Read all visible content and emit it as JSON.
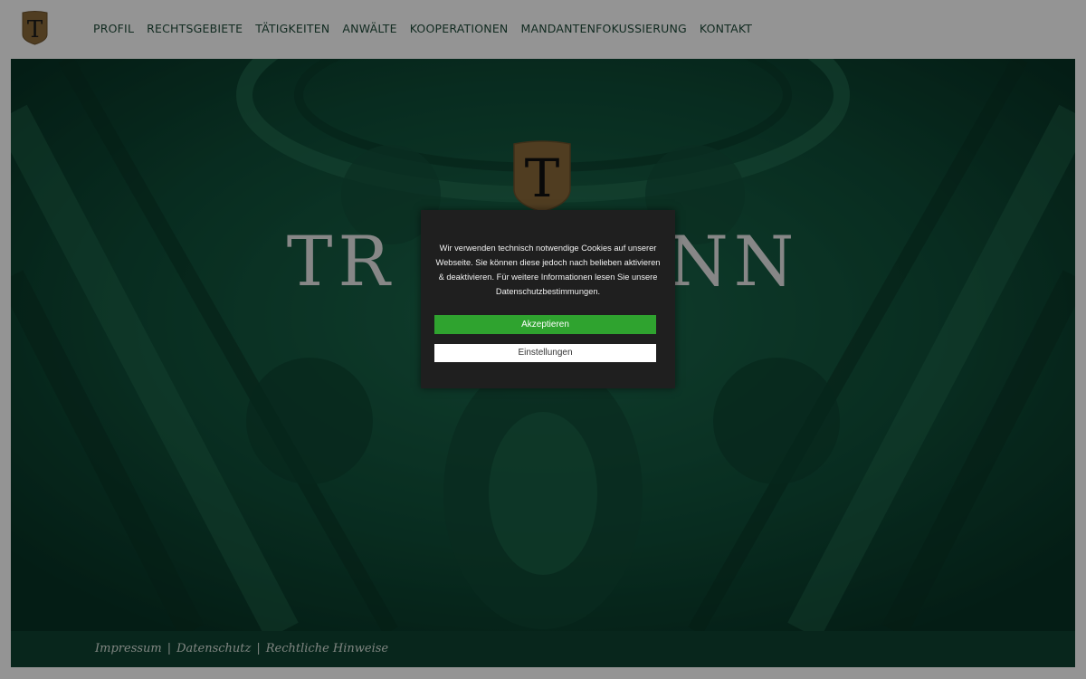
{
  "colors": {
    "brand_green": "#0e4a35",
    "accent_gold": "#8a6a3a",
    "accept_green": "#2fa32f"
  },
  "header": {
    "logo_letter": "T",
    "nav": [
      {
        "label": "PROFIL"
      },
      {
        "label": "RECHTSGEBIETE"
      },
      {
        "label": "TÄTIGKEITEN"
      },
      {
        "label": "ANWÄLTE"
      },
      {
        "label": "KOOPERATIONEN"
      },
      {
        "label": "MANDANTENFOKUSSIERUNG"
      },
      {
        "label": "KONTAKT"
      }
    ]
  },
  "hero": {
    "logo_letter": "T",
    "title": "TR          NN"
  },
  "cookie_banner": {
    "text": "Wir verwenden technisch notwendige Cookies auf unserer Webseite. Sie können diese jedoch nach belieben aktivieren & deaktivieren. Für weitere Informationen lesen Sie unsere Datenschutzbestimmungen.",
    "accept_label": " Akzeptieren",
    "settings_label": "Einstellungen"
  },
  "footer": {
    "links": [
      "Impressum",
      "Datenschutz",
      "Rechtliche Hinweise"
    ],
    "separator": "|"
  }
}
